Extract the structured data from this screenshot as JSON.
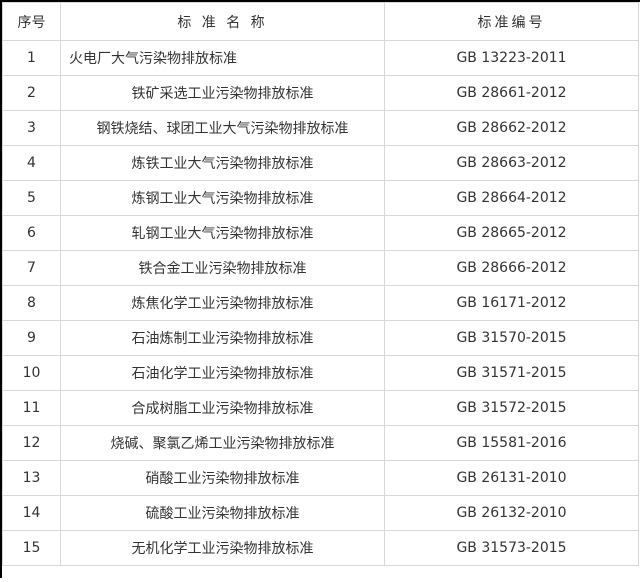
{
  "table": {
    "headers": {
      "no": "序号",
      "name": "标 准 名 称",
      "code": "标准编号"
    },
    "rows": [
      {
        "no": "1",
        "name": "火电厂大气污染物排放标准",
        "code": "GB 13223-2011",
        "align": "left"
      },
      {
        "no": "2",
        "name": "铁矿采选工业污染物排放标准",
        "code": "GB 28661-2012"
      },
      {
        "no": "3",
        "name": "钢铁烧结、球团工业大气污染物排放标准",
        "code": "GB 28662-2012"
      },
      {
        "no": "4",
        "name": "炼铁工业大气污染物排放标准",
        "code": "GB 28663-2012"
      },
      {
        "no": "5",
        "name": "炼钢工业大气污染物排放标准",
        "code": "GB 28664-2012"
      },
      {
        "no": "6",
        "name": "轧钢工业大气污染物排放标准",
        "code": "GB 28665-2012"
      },
      {
        "no": "7",
        "name": "铁合金工业污染物排放标准",
        "code": "GB 28666-2012"
      },
      {
        "no": "8",
        "name": "炼焦化学工业污染物排放标准",
        "code": "GB 16171-2012"
      },
      {
        "no": "9",
        "name": "石油炼制工业污染物排放标准",
        "code": "GB 31570-2015"
      },
      {
        "no": "10",
        "name": "石油化学工业污染物排放标准",
        "code": "GB 31571-2015"
      },
      {
        "no": "11",
        "name": "合成树脂工业污染物排放标准",
        "code": "GB 31572-2015"
      },
      {
        "no": "12",
        "name": "烧碱、聚氯乙烯工业污染物排放标准",
        "code": "GB 15581-2016"
      },
      {
        "no": "13",
        "name": "硝酸工业污染物排放标准",
        "code": "GB 26131-2010"
      },
      {
        "no": "14",
        "name": "硫酸工业污染物排放标准",
        "code": "GB 26132-2010"
      },
      {
        "no": "15",
        "name": "无机化学工业污染物排放标准",
        "code": "GB 31573-2015"
      }
    ]
  }
}
